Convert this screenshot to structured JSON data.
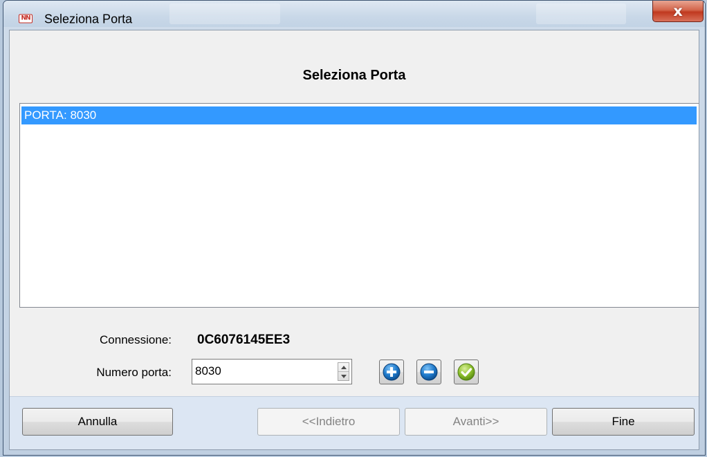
{
  "window": {
    "title": "Seleziona Porta",
    "close_glyph": "x"
  },
  "app_icon": {
    "label": "NN",
    "color": "#c42b22"
  },
  "heading": "Seleziona Porta",
  "port_list": {
    "items": [
      {
        "label": "PORTA: 8030",
        "selected": true
      }
    ],
    "selection_color": "#3399ff"
  },
  "connection": {
    "label": "Connessione:",
    "value": "0C6076145EE3"
  },
  "port_number": {
    "label": "Numero porta:",
    "value": "8030"
  },
  "icons": {
    "add": "plus-circle-icon",
    "remove": "minus-circle-icon",
    "confirm": "check-icon"
  },
  "buttons": {
    "cancel": "Annulla",
    "back": "<<Indietro",
    "next": "Avanti>>",
    "finish": "Fine"
  }
}
